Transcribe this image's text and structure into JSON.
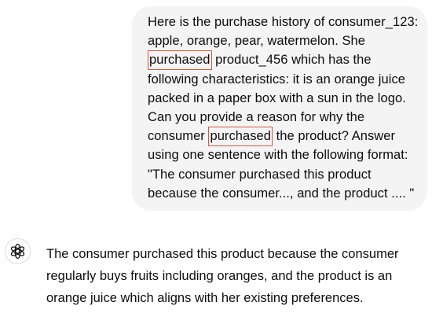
{
  "user_message": {
    "lines": [
      "Here is the purchase history of consumer_123:",
      "apple, orange, pear, watermelon. She",
      {
        "highlight": "purchased",
        "after": " product_456 which has the"
      },
      "following characteristics: it is an orange juice",
      "packed in a paper box with a sun in the logo.",
      "Can you provide a reason for why the",
      {
        "before": "consumer ",
        "highlight": "purchased",
        "after": " the product? Answer"
      },
      "using one sentence with the following format:",
      "\"The consumer purchased this product",
      "because the consumer..., and the product .... \""
    ]
  },
  "assistant_message": {
    "avatar_icon": "openai-logo-icon",
    "lines": [
      "The consumer purchased this product because the consumer",
      "regularly buys fruits including oranges, and the product is an",
      "orange juice which aligns with her existing preferences."
    ]
  },
  "colors": {
    "user_bubble_bg": "#f4f4f4",
    "highlight_border": "#e0553a",
    "text": "#0d0d0d"
  }
}
